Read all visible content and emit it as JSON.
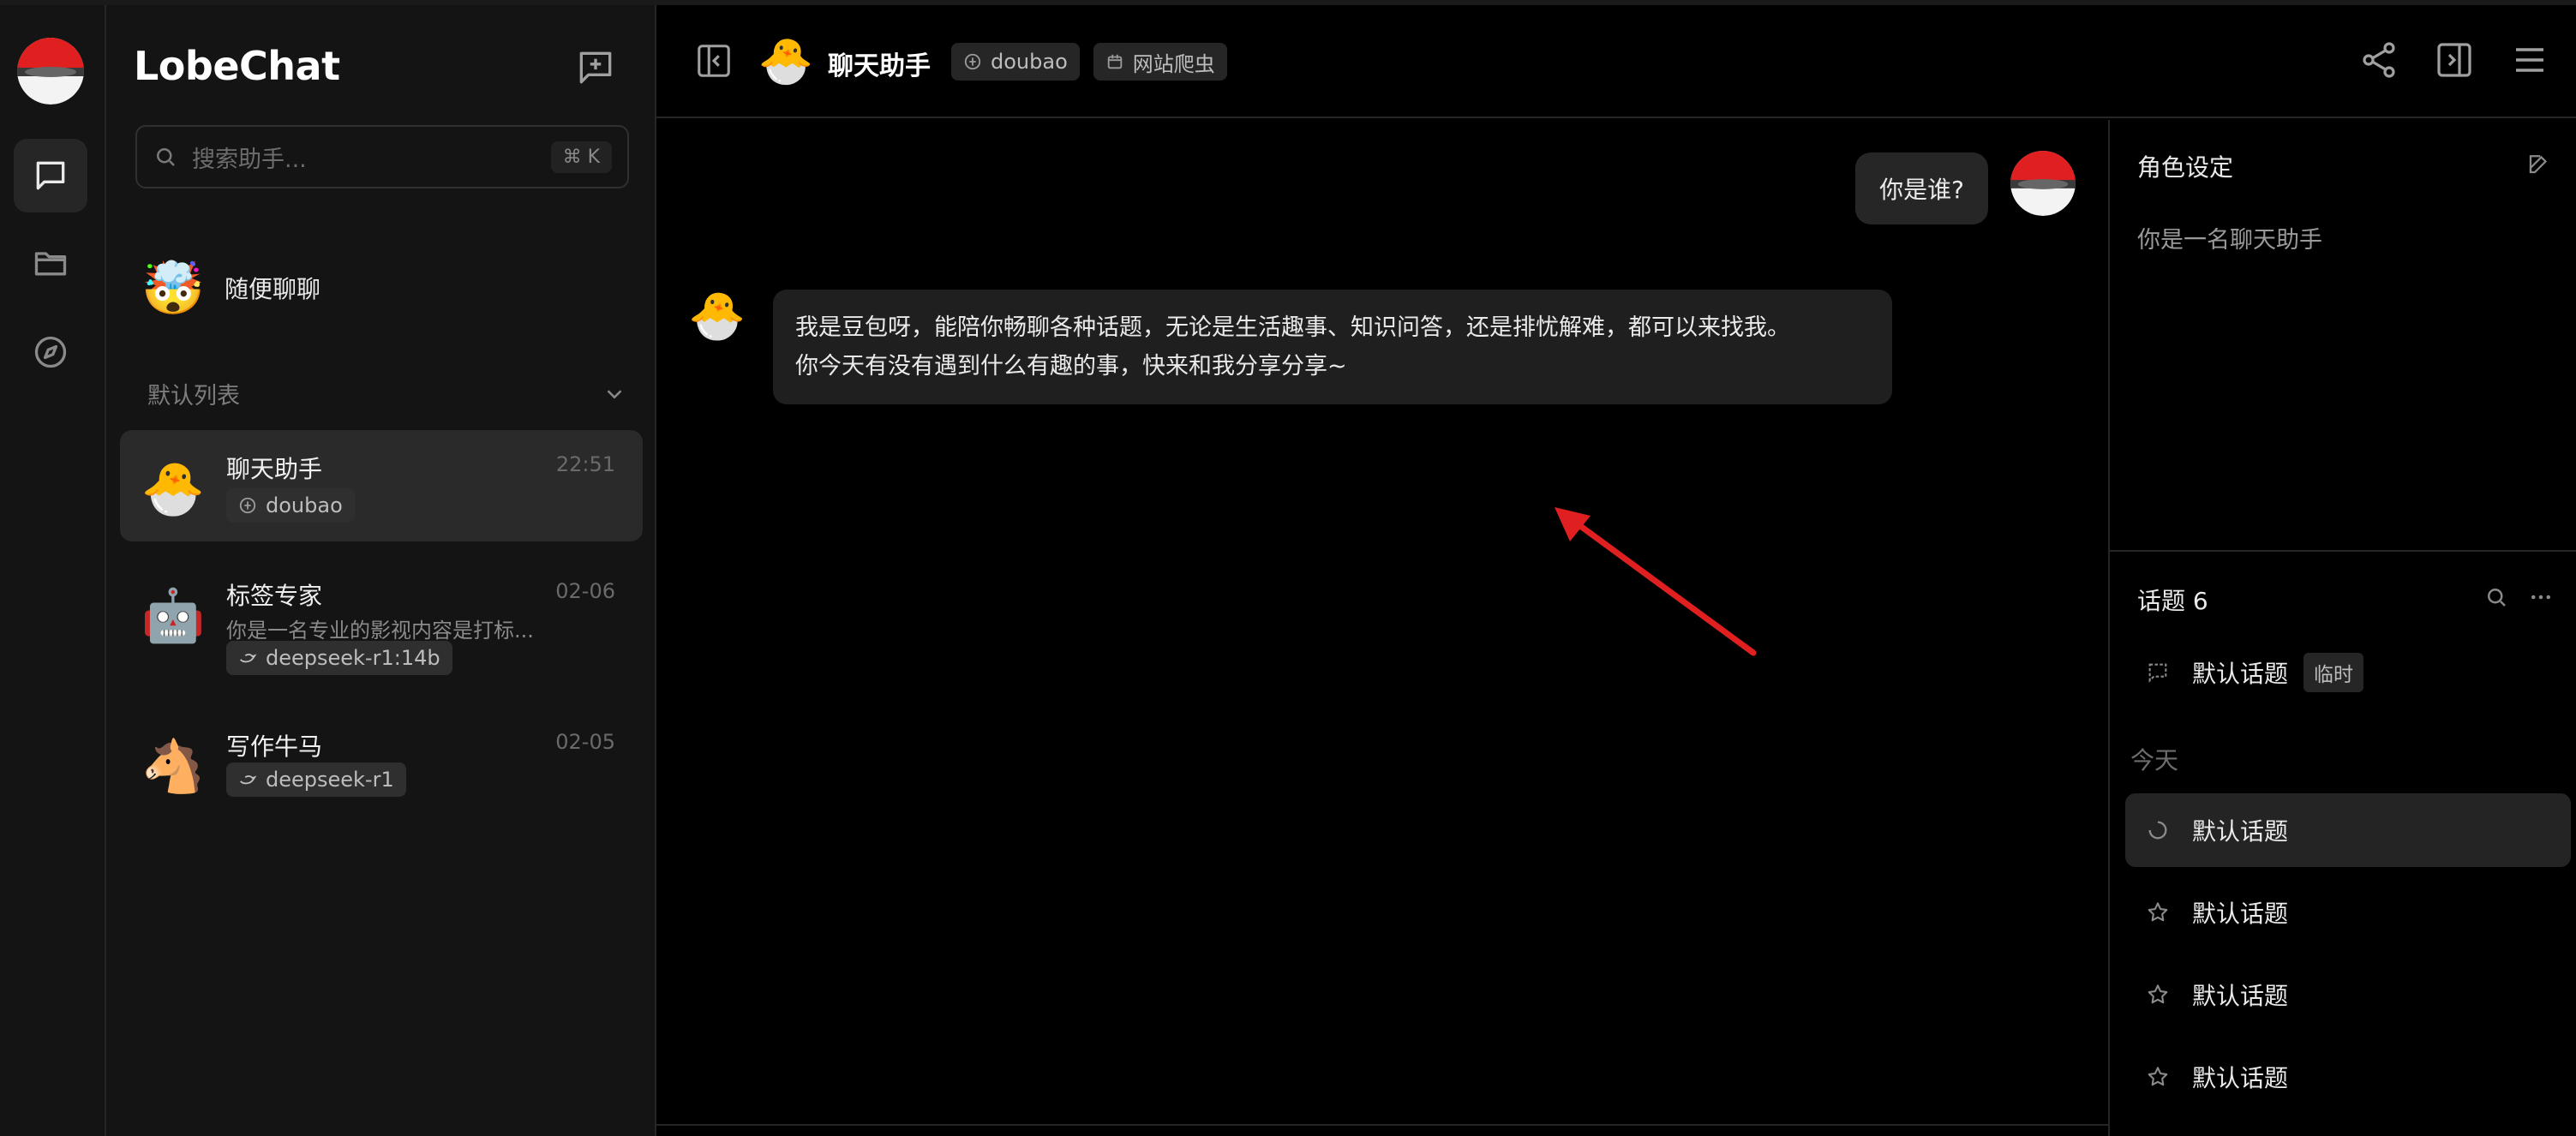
{
  "app": {
    "name": "LobeChat"
  },
  "sidebar": {
    "search_placeholder": "搜索助手...",
    "search_shortcut": "⌘ K",
    "quick_chat": "随便聊聊",
    "group_label": "默认列表",
    "sessions": [
      {
        "title": "聊天助手",
        "time": "22:51",
        "tag": "doubao",
        "desc": ""
      },
      {
        "title": "标签专家",
        "time": "02-06",
        "tag": "deepseek-r1:14b",
        "desc": "你是一名专业的影视内容是打标..."
      },
      {
        "title": "写作牛马",
        "time": "02-05",
        "tag": "deepseek-r1",
        "desc": ""
      }
    ]
  },
  "header": {
    "title": "聊天助手",
    "model_tag": "doubao",
    "plugin_tag": "网站爬虫"
  },
  "chat": {
    "user_message": "你是谁?",
    "bot_message_line1": "我是豆包呀，能陪你畅聊各种话题，无论是生活趣事、知识问答，还是排忧解难，都可以来找我。",
    "bot_message_line2": "你今天有没有遇到什么有趣的事，快来和我分享分享~"
  },
  "panel": {
    "role_title": "角色设定",
    "role_text": "你是一名聊天助手",
    "topics_title": "话题 6",
    "default_topic": "默认话题",
    "temp_badge": "临时",
    "today_label": "今天",
    "topics": [
      "默认话题",
      "默认话题",
      "默认话题",
      "默认话题"
    ]
  },
  "colors": {
    "background": "#000000",
    "sidebar": "#141414",
    "bubble": "#262626",
    "accent_red": "#e02020"
  }
}
